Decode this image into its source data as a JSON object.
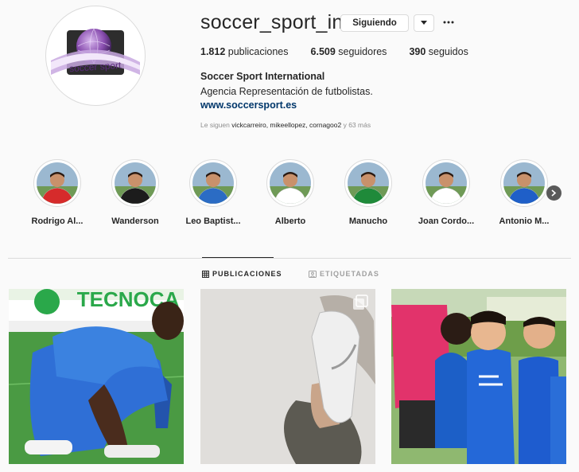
{
  "profile": {
    "username": "soccer_sport_int",
    "follow_label": "Siguiendo",
    "avatar_text": "soccer sport",
    "stats": {
      "posts_count": "1.812",
      "posts_label": "publicaciones",
      "followers_count": "6.509",
      "followers_label": "seguidores",
      "following_count": "390",
      "following_label": "seguidos"
    },
    "full_name": "Soccer Sport International",
    "bio": "Agencia Representación de futbolistas.",
    "website": "www.soccersport.es",
    "followed_by": {
      "prefix": "Le siguen",
      "names": "vickcarreiro, mikeellopez, cornagoo2",
      "suffix": "y 63 más"
    }
  },
  "highlights": [
    {
      "label": "Rodrigo Al...",
      "kit": "#d62b2b"
    },
    {
      "label": "Wanderson",
      "kit": "#1c1c1c"
    },
    {
      "label": "Leo Baptist...",
      "kit": "#2b6cc4"
    },
    {
      "label": "Alberto",
      "kit": "#ffffff"
    },
    {
      "label": "Manucho",
      "kit": "#1f8a3a"
    },
    {
      "label": "Joan Cordo...",
      "kit": "#ffffff"
    },
    {
      "label": "Antonio M...",
      "kit": "#1f5fc8"
    }
  ],
  "tabs": {
    "posts": "PUBLICACIONES",
    "tagged": "ETIQUETADAS"
  },
  "posts_banner_text": "TECNOCA",
  "colors": {
    "link": "#00376b",
    "border": "#dbdbdb",
    "muted": "#8e8e8e",
    "avatar_purple": "#a07cc0"
  }
}
